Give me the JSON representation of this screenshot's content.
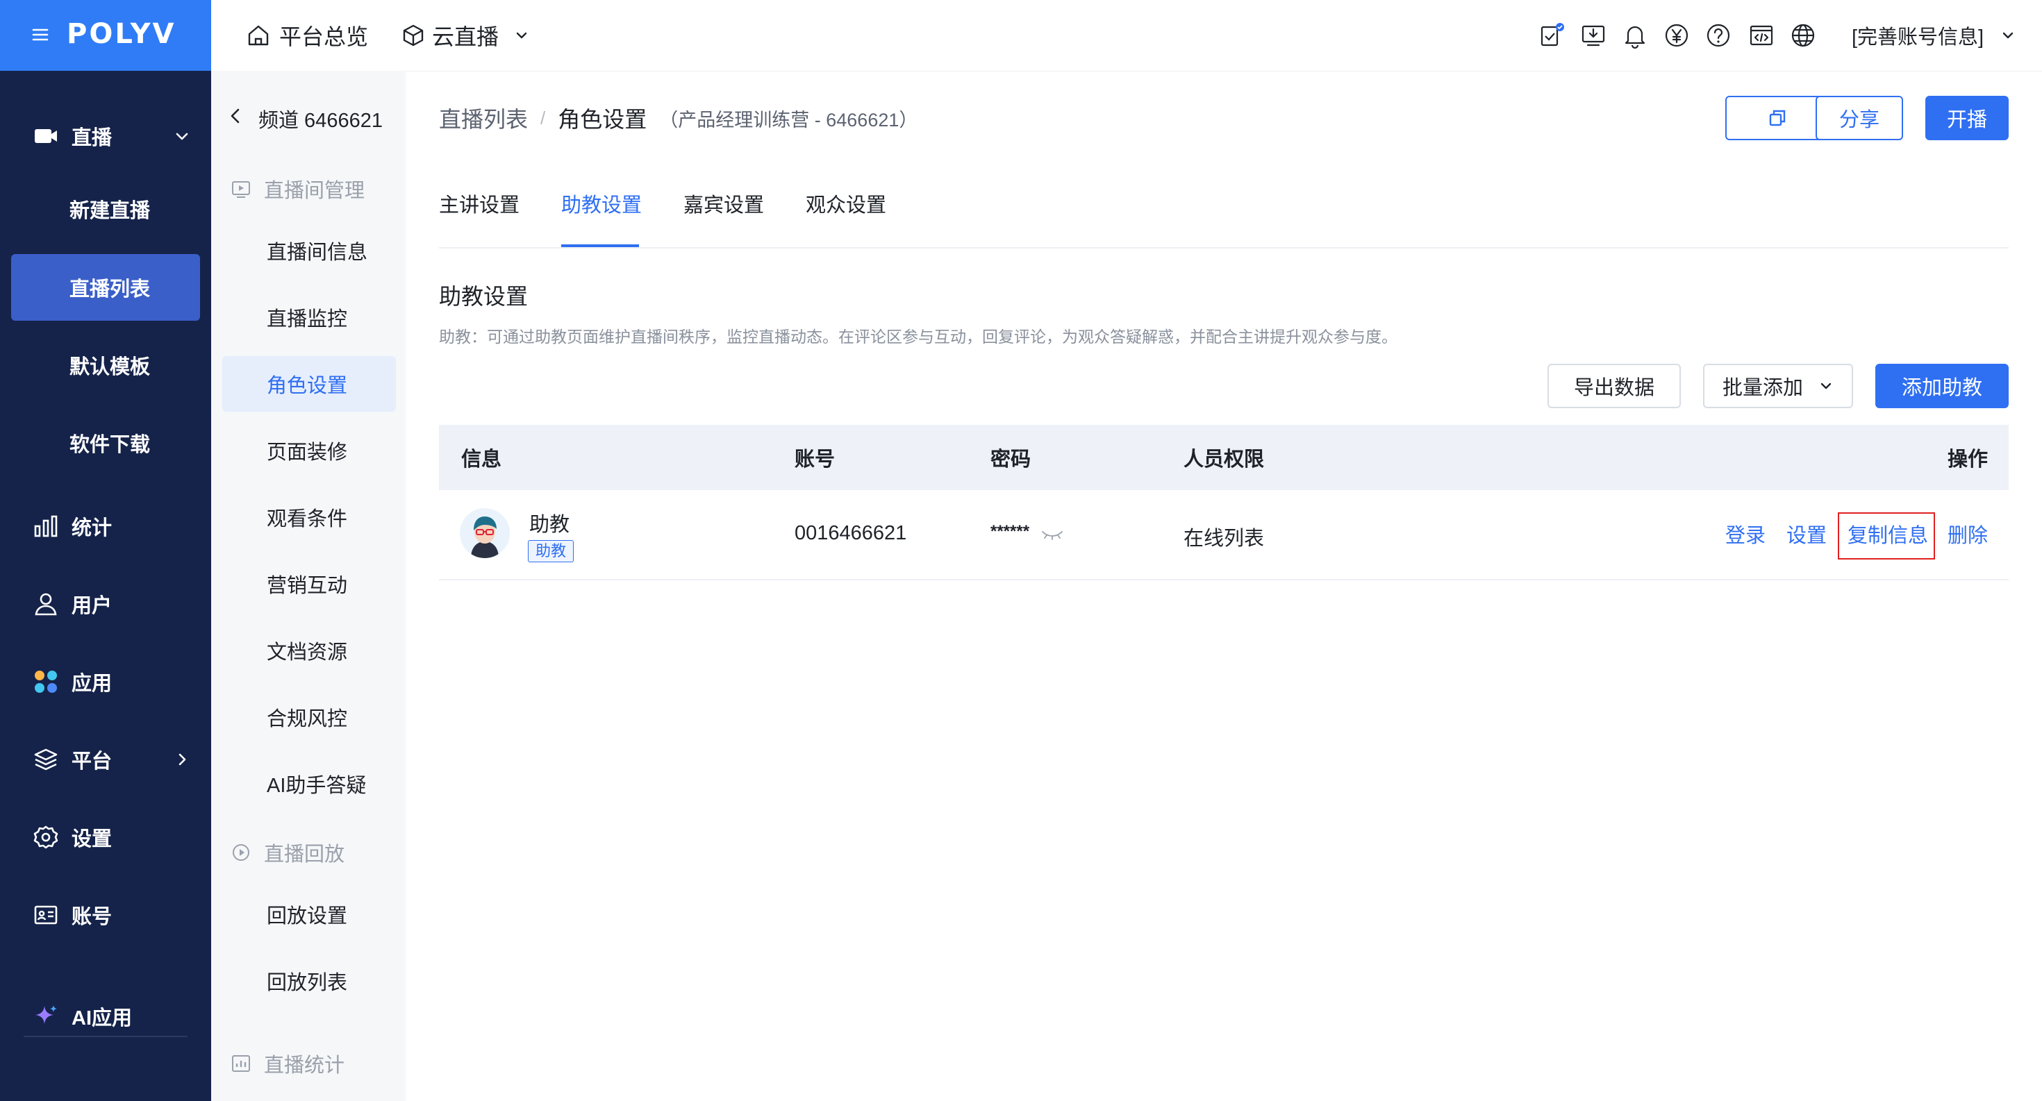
{
  "brand": {
    "logo": "POLYV",
    "menu_icon": "hamburger-icon"
  },
  "header": {
    "home_label": "平台总览",
    "product_label": "云直播",
    "account_label": "[完善账号信息]",
    "icons": [
      "task-check-icon",
      "download-icon",
      "bell-icon",
      "yen-icon",
      "help-icon",
      "code-icon",
      "globe-icon"
    ]
  },
  "sidebar": {
    "items": [
      {
        "label": "直播",
        "icon": "video-camera-icon"
      },
      {
        "label": "新建直播"
      },
      {
        "label": "直播列表",
        "active": true
      },
      {
        "label": "默认模板"
      },
      {
        "label": "软件下载"
      },
      {
        "label": "统计",
        "icon": "bar-chart-icon"
      },
      {
        "label": "用户",
        "icon": "user-icon"
      },
      {
        "label": "应用",
        "icon": "apps-icon"
      },
      {
        "label": "平台",
        "icon": "layers-icon"
      },
      {
        "label": "设置",
        "icon": "gear-icon"
      },
      {
        "label": "账号",
        "icon": "id-card-icon"
      },
      {
        "label": "AI应用",
        "icon": "sparkle-icon"
      }
    ]
  },
  "subnav": {
    "channel_title": "频道 6466621",
    "group_live_room": "直播间管理",
    "items": [
      "直播间信息",
      "直播监控",
      "角色设置",
      "页面装修",
      "观看条件",
      "营销互动",
      "文档资源",
      "合规风控",
      "AI助手答疑"
    ],
    "group_playback": "直播回放",
    "playback_items": [
      "回放设置",
      "回放列表"
    ],
    "group_stats": "直播统计"
  },
  "breadcrumb": {
    "parent": "直播列表",
    "separator": "/",
    "current": "角色设置",
    "meta": "（产品经理训练营 - 6466621）"
  },
  "top_actions": {
    "share": "分享",
    "start": "开播",
    "copy_icon": "copy-icon"
  },
  "tabs": [
    {
      "label": "主讲设置"
    },
    {
      "label": "助教设置",
      "active": true
    },
    {
      "label": "嘉宾设置"
    },
    {
      "label": "观众设置"
    }
  ],
  "section": {
    "title": "助教设置",
    "desc": "助教：可通过助教页面维护直播间秩序，监控直播动态。在评论区参与互动，回复评论，为观众答疑解惑，并配合主讲提升观众参与度。"
  },
  "toolbar": {
    "export": "导出数据",
    "batch_add": "批量添加",
    "add_assistant": "添加助教"
  },
  "table": {
    "headers": {
      "info": "信息",
      "account": "账号",
      "password": "密码",
      "permission": "人员权限",
      "ops": "操作"
    },
    "rows": [
      {
        "name": "助教",
        "tag": "助教",
        "account": "0016466621",
        "password": "******",
        "permission": "在线列表",
        "ops": {
          "login": "登录",
          "settings": "设置",
          "copy": "复制信息",
          "delete": "删除"
        }
      }
    ]
  },
  "colors": {
    "brand_blue": "#2f7cf6",
    "sidebar_bg": "#15234a",
    "accent": "#2f6ff2",
    "highlight_box": "#e02020"
  }
}
